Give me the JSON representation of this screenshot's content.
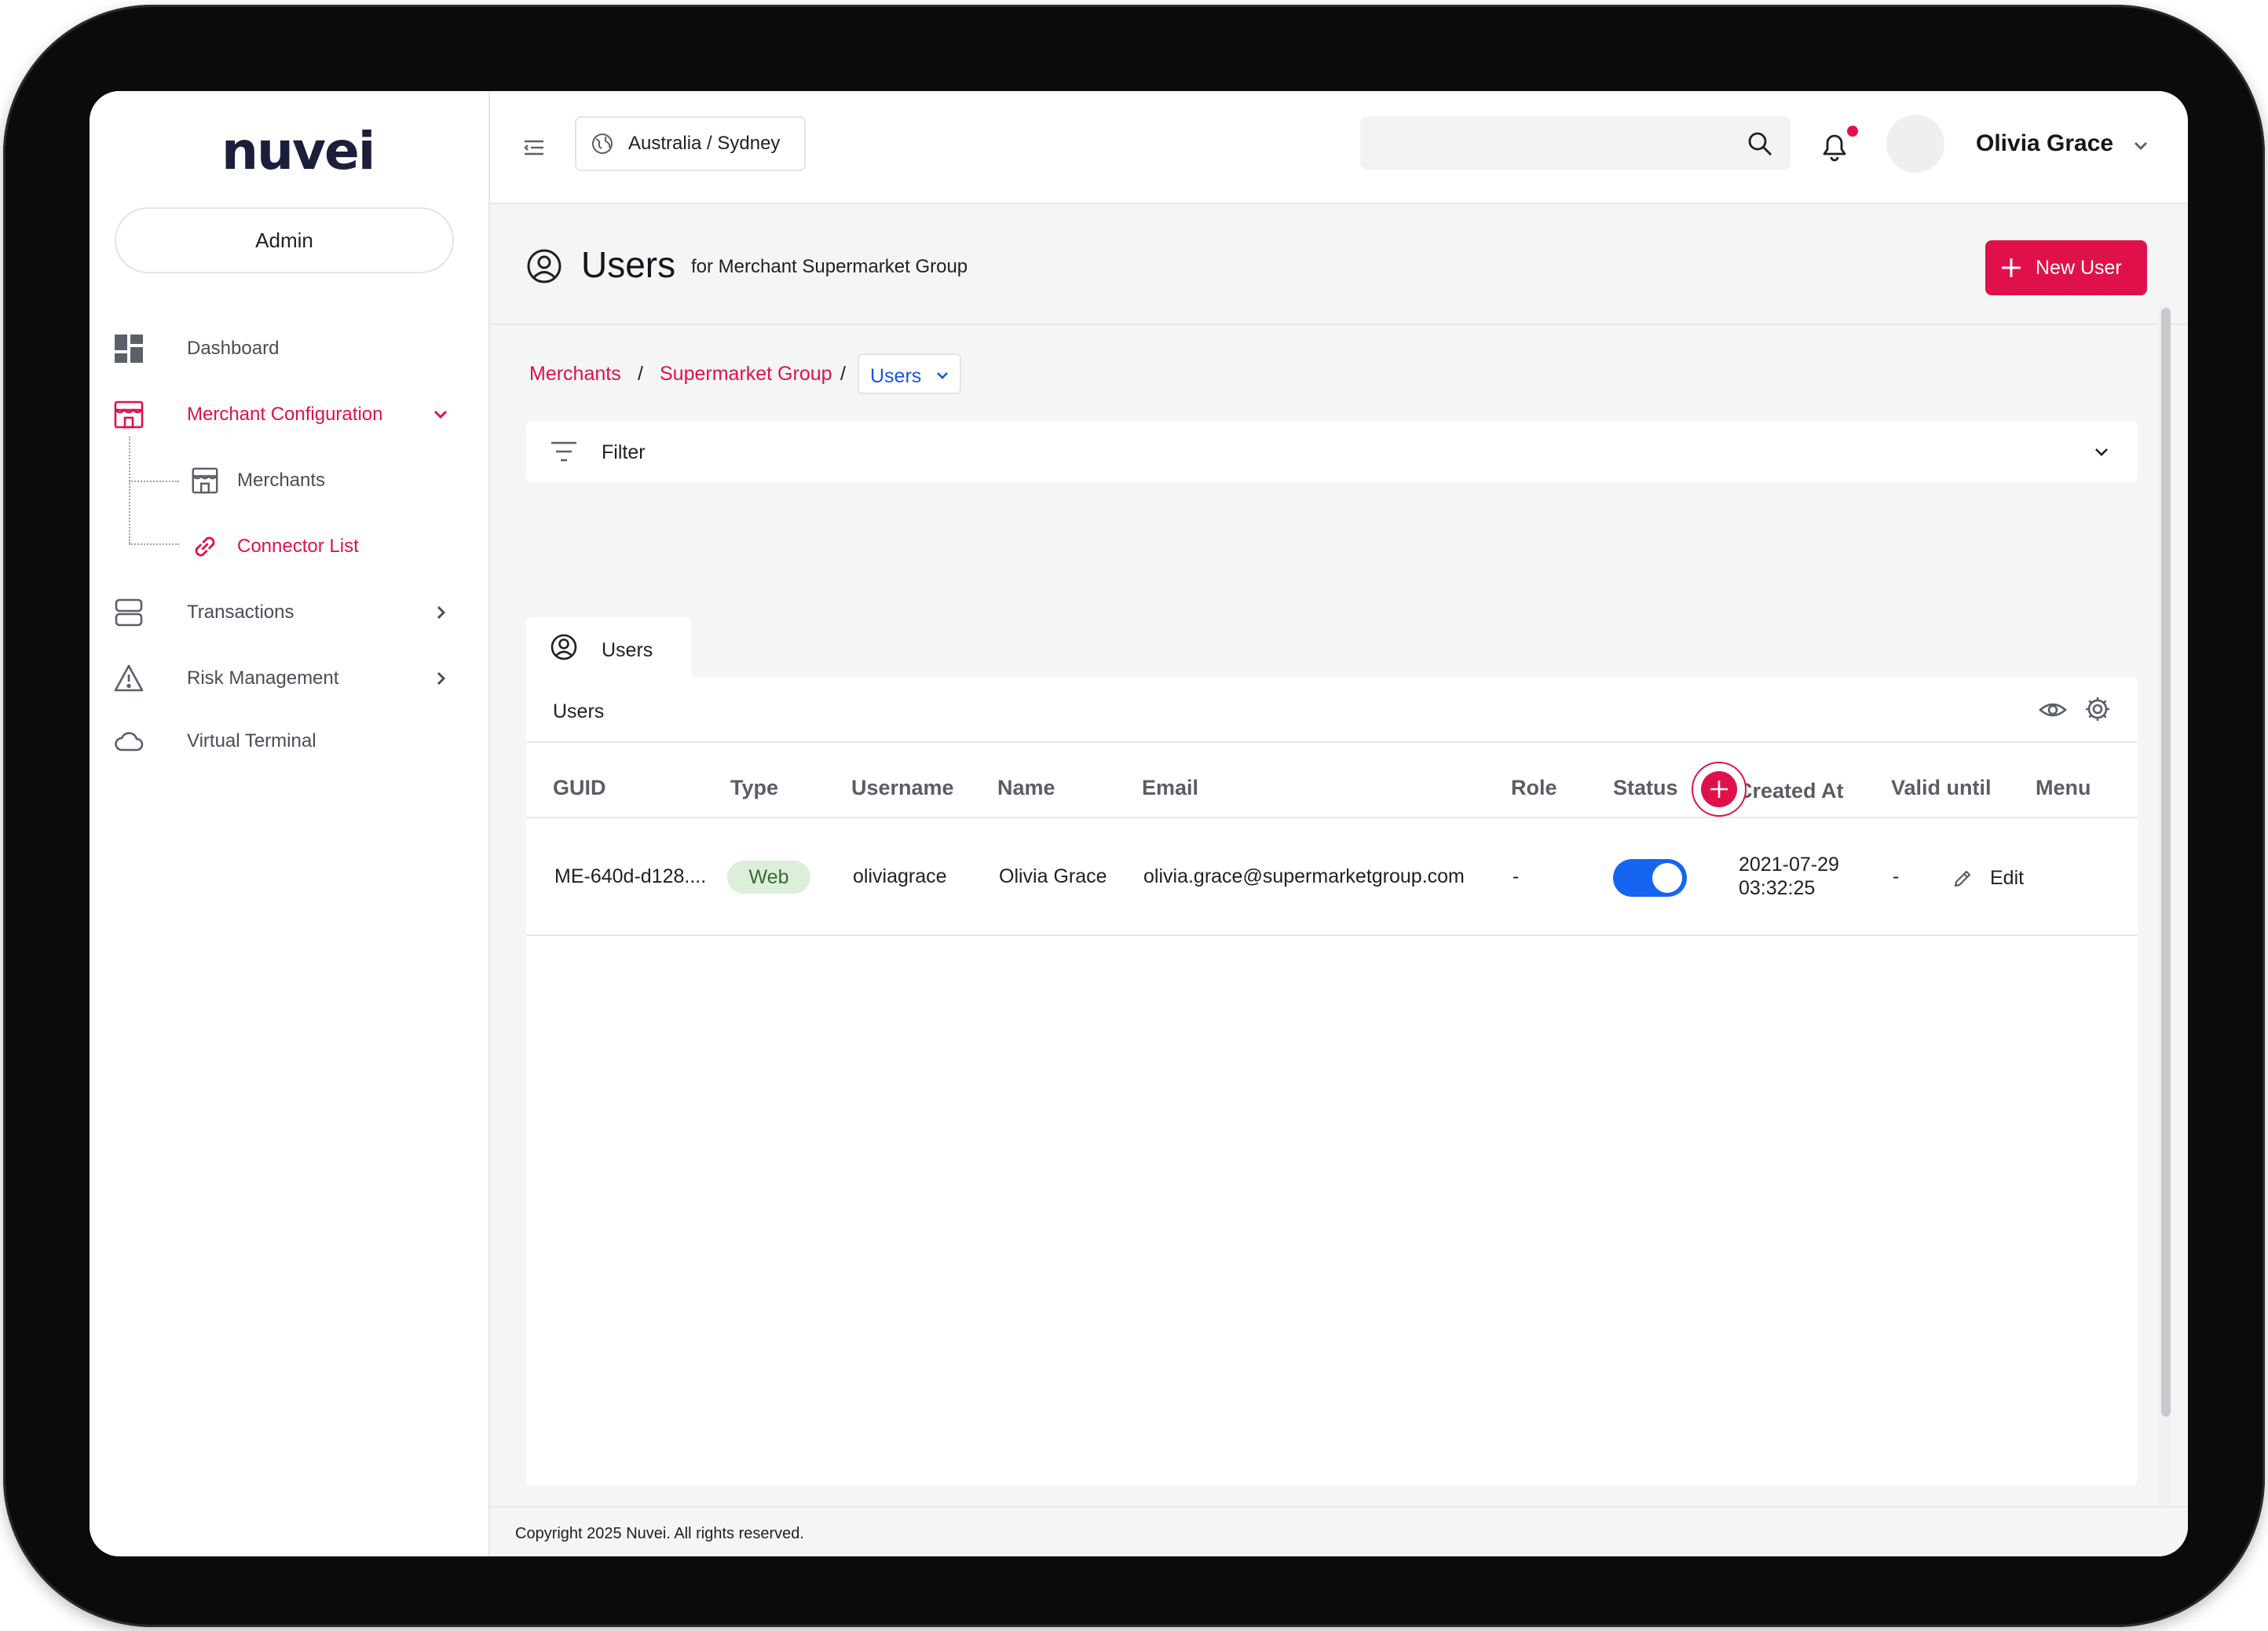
{
  "brand": {
    "logo_text": "nuvei",
    "accent_color": "#e0114a"
  },
  "sidebar": {
    "role_label": "Admin",
    "items": [
      {
        "label": "Dashboard",
        "icon": "dashboard-icon"
      },
      {
        "label": "Merchant Configuration",
        "icon": "storefront-icon",
        "expanded": true
      },
      {
        "label": "Transactions",
        "icon": "server-icon"
      },
      {
        "label": "Risk Management",
        "icon": "warning-icon"
      },
      {
        "label": "Virtual Terminal",
        "icon": "cloud-icon"
      }
    ],
    "sub_items": [
      {
        "label": "Merchants",
        "icon": "store-icon"
      },
      {
        "label": "Connector List",
        "icon": "link-icon",
        "active": true
      }
    ]
  },
  "header": {
    "timezone": "Australia / Sydney",
    "search_placeholder": "",
    "user_name": "Olivia Grace",
    "has_notification": true
  },
  "page": {
    "title": "Users",
    "subtitle": "for Merchant Supermarket Group",
    "new_button": "New User"
  },
  "breadcrumb": {
    "items": [
      "Merchants",
      "Supermarket Group"
    ],
    "separator": "/",
    "current": "Users"
  },
  "filter": {
    "label": "Filter"
  },
  "tab": {
    "label": "Users"
  },
  "table": {
    "title": "Users",
    "columns": [
      "GUID",
      "Type",
      "Username",
      "Name",
      "Email",
      "Role",
      "Status",
      "Created At",
      "Valid until",
      "Menu"
    ],
    "rows": [
      {
        "guid": "ME-640d-d128....",
        "type": "Web",
        "username": "oliviagrace",
        "name": "Olivia Grace",
        "email": "olivia.grace@supermarketgroup.com",
        "role": "-",
        "status_on": true,
        "created_date": "2021-07-29",
        "created_time": "03:32:25",
        "valid_until": "-",
        "menu_action": "Edit"
      }
    ]
  },
  "footer": {
    "copyright": "Copyright 2025 Nuvei. All rights reserved."
  }
}
